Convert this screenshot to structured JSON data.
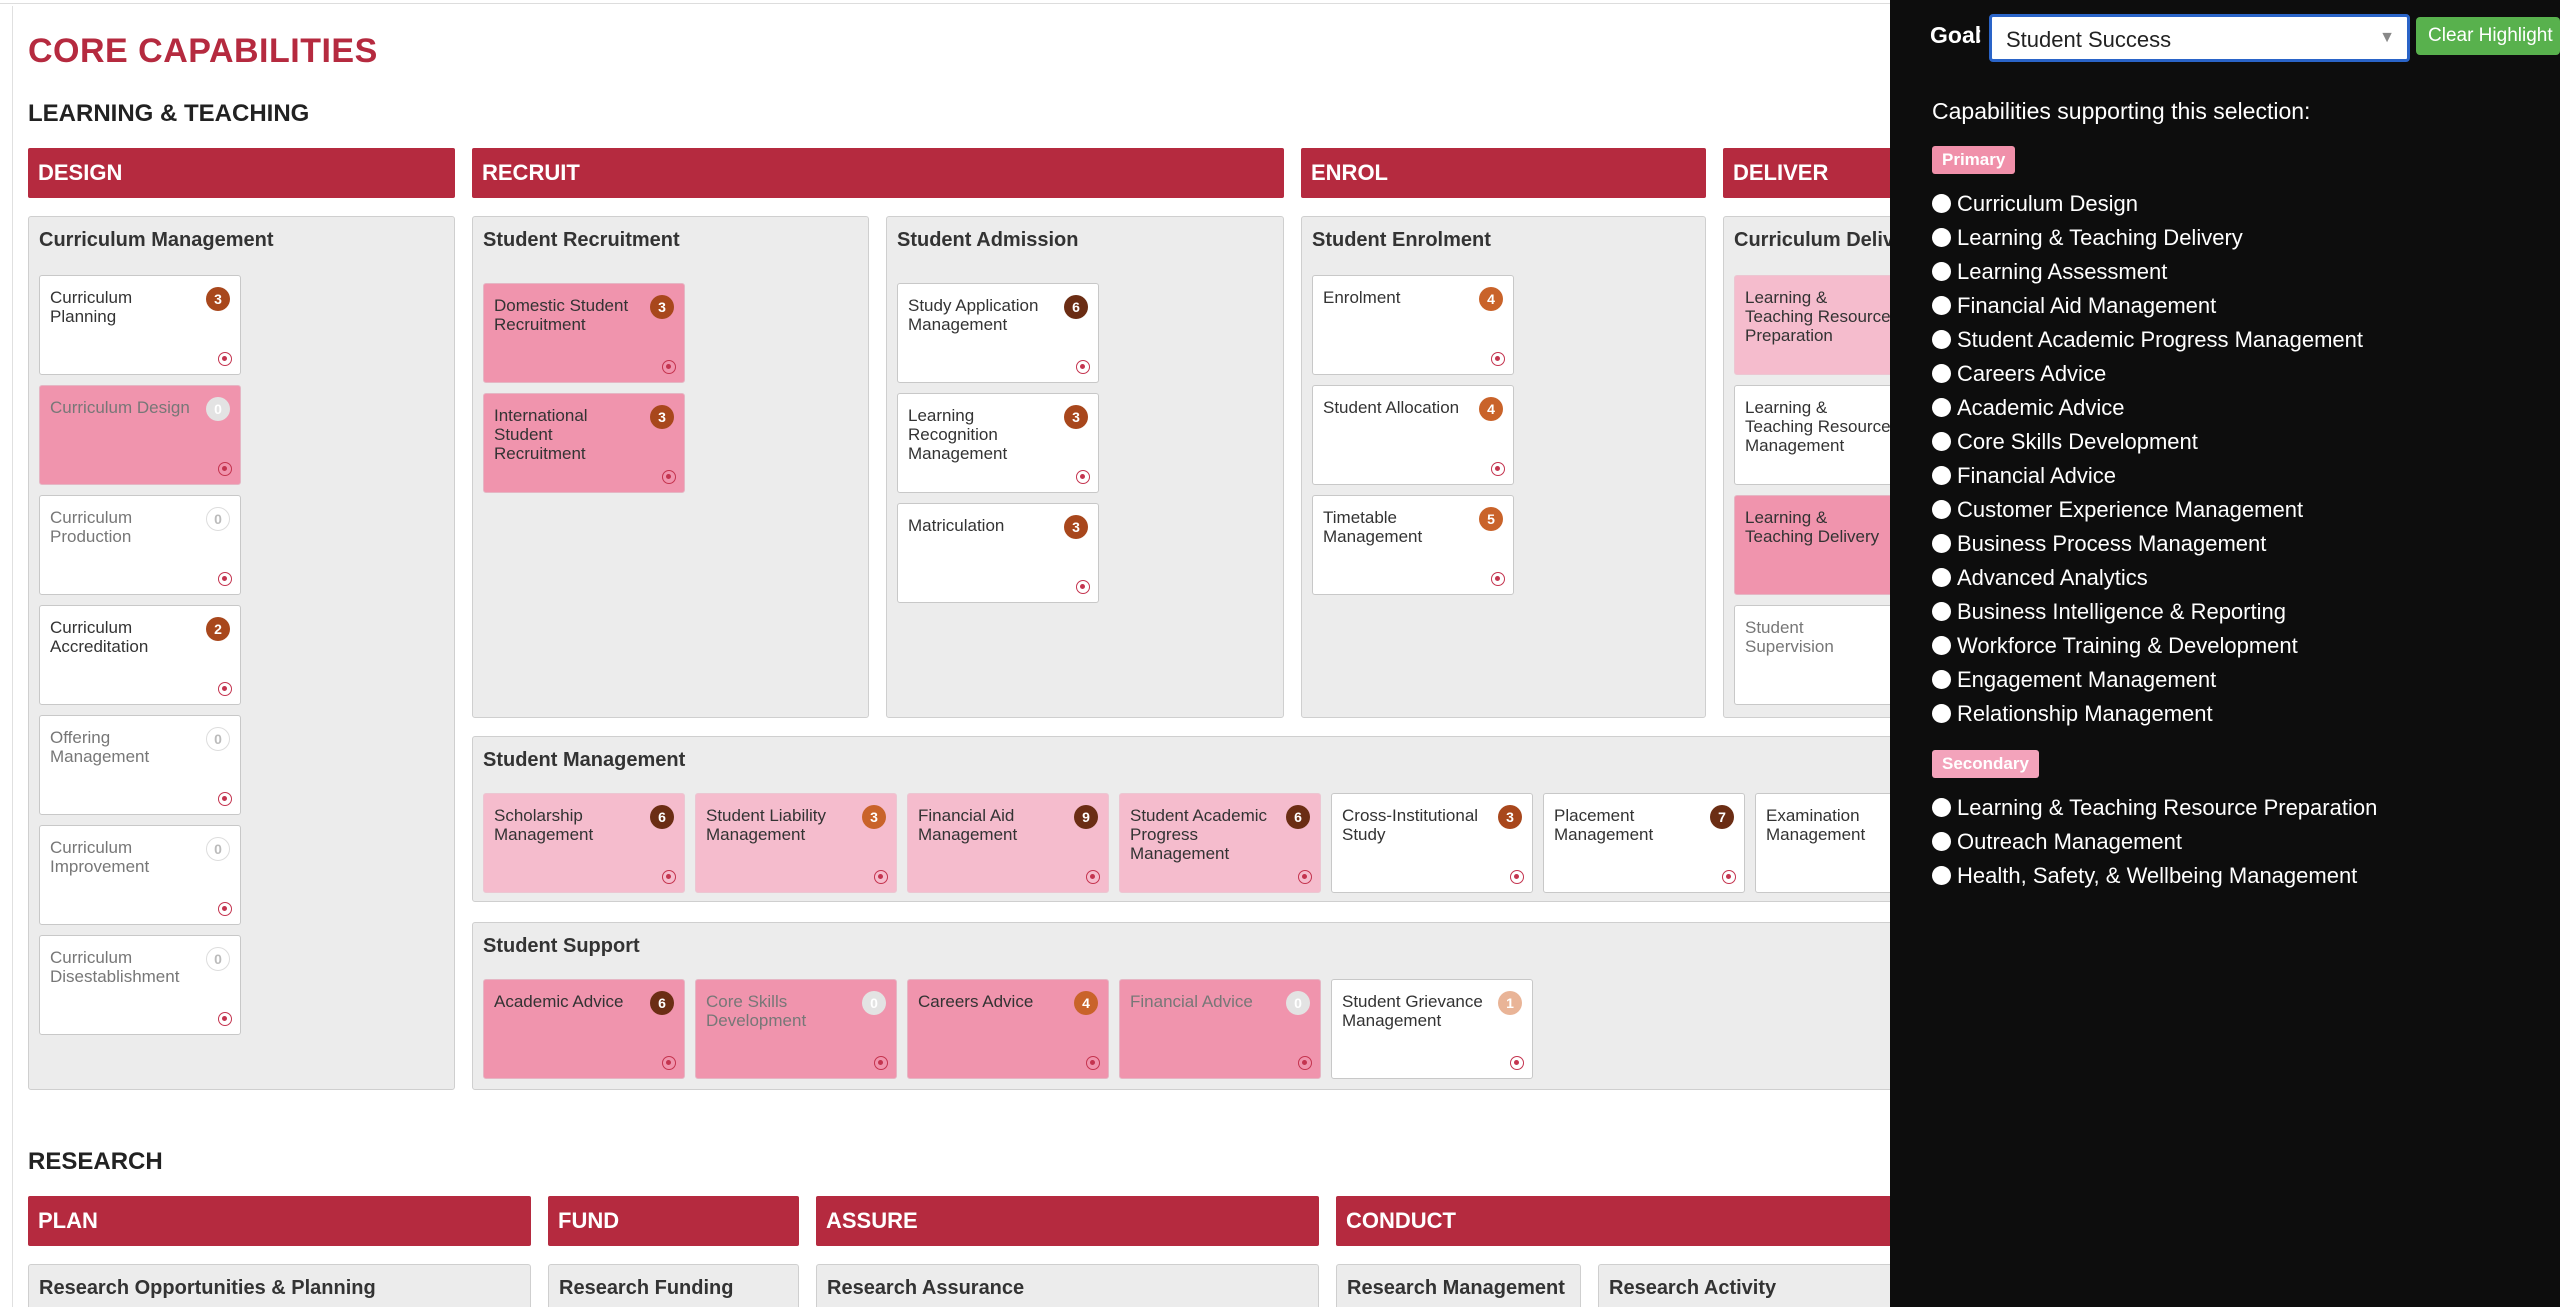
{
  "page_title": "CORE CAPABILITIES",
  "sections": {
    "learning_teaching": "LEARNING & TEACHING",
    "research": "RESEARCH"
  },
  "phases": {
    "design": "DESIGN",
    "recruit": "RECRUIT",
    "enrol": "ENROL",
    "deliver": "DELIVER",
    "plan": "PLAN",
    "fund": "FUND",
    "assure": "ASSURE",
    "conduct": "CONDUCT"
  },
  "groups": {
    "curriculum_management": {
      "title": "Curriculum Management",
      "cards": [
        {
          "label": "Curriculum Planning",
          "count": "3"
        },
        {
          "label": "Curriculum Design",
          "count": "0"
        },
        {
          "label": "Curriculum Production",
          "count": "0"
        },
        {
          "label": "Curriculum Accreditation",
          "count": "2"
        },
        {
          "label": "Offering Management",
          "count": "0"
        },
        {
          "label": "Curriculum Improvement",
          "count": "0"
        },
        {
          "label": "Curriculum Disestablishment",
          "count": "0"
        }
      ]
    },
    "student_recruitment": {
      "title": "Student Recruitment",
      "cards": [
        {
          "label": "Domestic Student Recruitment",
          "count": "3"
        },
        {
          "label": "International Student Recruitment",
          "count": "3"
        }
      ]
    },
    "student_admission": {
      "title": "Student Admission",
      "cards": [
        {
          "label": "Study Application Management",
          "count": "6"
        },
        {
          "label": "Learning Recognition Management",
          "count": "3"
        },
        {
          "label": "Matriculation",
          "count": "3"
        }
      ]
    },
    "student_enrolment": {
      "title": "Student Enrolment",
      "cards": [
        {
          "label": "Enrolment",
          "count": "4"
        },
        {
          "label": "Student Allocation",
          "count": "4"
        },
        {
          "label": "Timetable Management",
          "count": "5"
        }
      ]
    },
    "curriculum_delivery": {
      "title": "Curriculum Deliv",
      "cards": [
        {
          "label": "Learning & Teaching Resource Preparation"
        },
        {
          "label": "Learning & Teaching Resource Management"
        },
        {
          "label": "Learning & Teaching Delivery"
        },
        {
          "label": "Student Supervision"
        }
      ]
    },
    "student_management": {
      "title": "Student Management",
      "cards": [
        {
          "label": "Scholarship Management",
          "count": "6"
        },
        {
          "label": "Student Liability Management",
          "count": "3"
        },
        {
          "label": "Financial Aid Management",
          "count": "9"
        },
        {
          "label": "Student Academic Progress Management",
          "count": "6"
        },
        {
          "label": "Cross-Institutional Study",
          "count": "3"
        },
        {
          "label": "Placement Management",
          "count": "7"
        },
        {
          "label": "Examination Management"
        }
      ]
    },
    "student_support": {
      "title": "Student Support",
      "cards": [
        {
          "label": "Academic Advice",
          "count": "6"
        },
        {
          "label": "Core Skills Development",
          "count": "0"
        },
        {
          "label": "Careers Advice",
          "count": "4"
        },
        {
          "label": "Financial Advice",
          "count": "0"
        },
        {
          "label": "Student Grievance Management",
          "count": "1"
        }
      ]
    },
    "research_groups": {
      "opportunities": "Research Opportunities & Planning",
      "funding": "Research Funding",
      "assurance": "Research Assurance",
      "management": "Research Management",
      "activity": "Research Activity"
    }
  },
  "panel": {
    "goal_label": "Goal",
    "goal_colon": ":",
    "goal_value": "Student Success",
    "clear_label": "Clear Highlight",
    "heading": "Capabilities supporting this selection:",
    "primary_tag": "Primary",
    "secondary_tag": "Secondary",
    "primary": [
      "Curriculum Design",
      "Learning & Teaching Delivery",
      "Learning Assessment",
      "Financial Aid Management",
      "Student Academic Progress Management",
      "Careers Advice",
      "Academic Advice",
      "Core Skills Development",
      "Financial Advice",
      "Customer Experience Management",
      "Business Process Management",
      "Advanced Analytics",
      "Business Intelligence & Reporting",
      "Workforce Training & Development",
      "Engagement Management",
      "Relationship Management"
    ],
    "secondary": [
      "Learning & Teaching Resource Preparation",
      "Outreach Management",
      "Health, Safety, & Wellbeing Management"
    ]
  },
  "colors": {
    "brand": "#b52a3f",
    "primary_highlight": "#f094ad",
    "secondary_highlight": "#f5bccd",
    "clear_button": "#58b14d",
    "panel_bg": "#0d0d0d"
  },
  "icons": {
    "card_target": "target-icon",
    "select_caret": "caret-down-icon",
    "list_bullet": "radio-icon"
  }
}
